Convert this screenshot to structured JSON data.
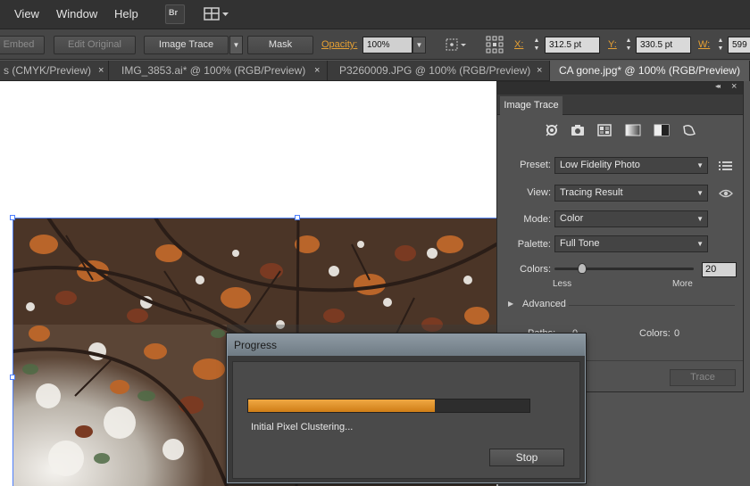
{
  "menubar": {
    "items": [
      "View",
      "Window",
      "Help"
    ],
    "bridge_label": "Br"
  },
  "controlbar": {
    "embed_label": "Embed",
    "edit_original_label": "Edit Original",
    "image_trace_label": "Image Trace",
    "mask_label": "Mask",
    "opacity_label": "Opacity:",
    "opacity_value": "100%",
    "x_label": "X:",
    "x_value": "312.5 pt",
    "y_label": "Y:",
    "y_value": "330.5 pt",
    "w_label": "W:",
    "w_value": "599"
  },
  "tabs": [
    {
      "label": "s (CMYK/Preview)",
      "active": false
    },
    {
      "label": "IMG_3853.ai* @ 100% (RGB/Preview)",
      "active": false
    },
    {
      "label": "P3260009.JPG @ 100% (RGB/Preview)",
      "active": false
    },
    {
      "label": "CA gone.jpg* @ 100% (RGB/Preview)",
      "active": true
    }
  ],
  "tab_close_glyph": "×",
  "panel": {
    "title": "Image Trace",
    "collapse_glyph": "◂◂",
    "close_glyph": "×",
    "icons": [
      "auto-color-icon",
      "high-color-icon",
      "low-color-icon",
      "grayscale-icon",
      "black-white-icon",
      "outline-icon"
    ],
    "preset_label": "Preset:",
    "preset_value": "Low Fidelity Photo",
    "view_label": "View:",
    "view_value": "Tracing Result",
    "mode_label": "Mode:",
    "mode_value": "Color",
    "palette_label": "Palette:",
    "palette_value": "Full Tone",
    "colors_label": "Colors:",
    "colors_value": "20",
    "colors_slider_level": 0.2,
    "less_label": "Less",
    "more_label": "More",
    "advanced_label": "Advanced",
    "paths_label": "Paths:",
    "paths_value": "0",
    "info_colors_label": "Colors:",
    "info_colors_value": "0",
    "trace_label": "Trace"
  },
  "progress": {
    "title": "Progress",
    "status": "Initial Pixel Clustering...",
    "fraction": 0.665,
    "stop_label": "Stop"
  },
  "colors": {
    "accent_orange": "#e39a2a",
    "selection_blue": "#4f80ff"
  }
}
